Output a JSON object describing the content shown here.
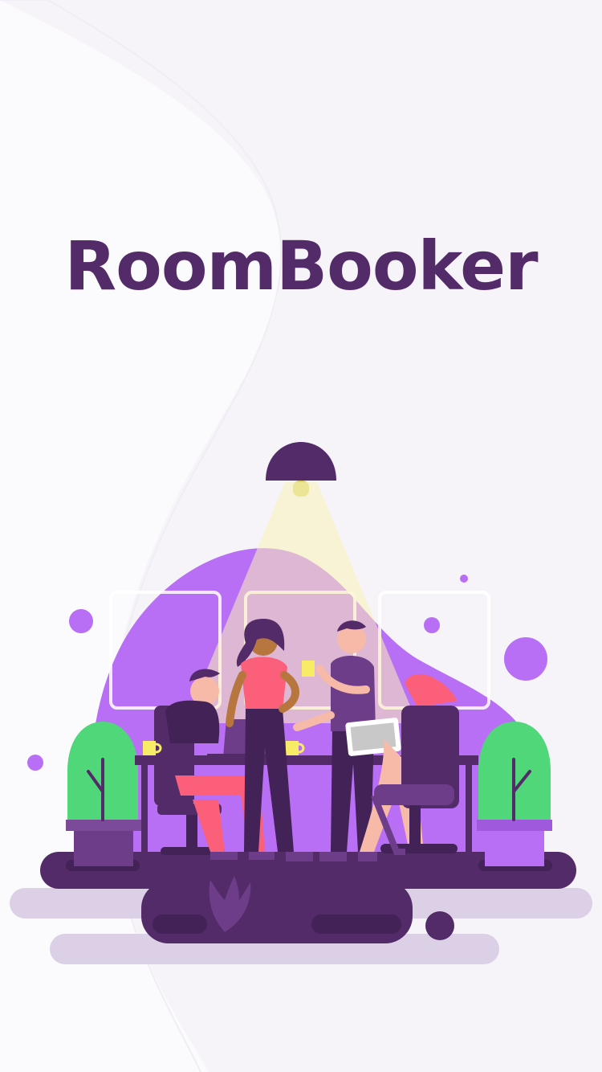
{
  "app": {
    "title": "RoomBooker"
  },
  "colors": {
    "background": "#f6f4f9",
    "brand_dark": "#532b69",
    "brand_purple": "#b86ff5",
    "lamp_glow": "#fbf3b8",
    "plant_green": "#4fd77a",
    "accent_pink": "#fb5f79"
  },
  "icons": {
    "illustration": "meeting-room-illustration"
  }
}
